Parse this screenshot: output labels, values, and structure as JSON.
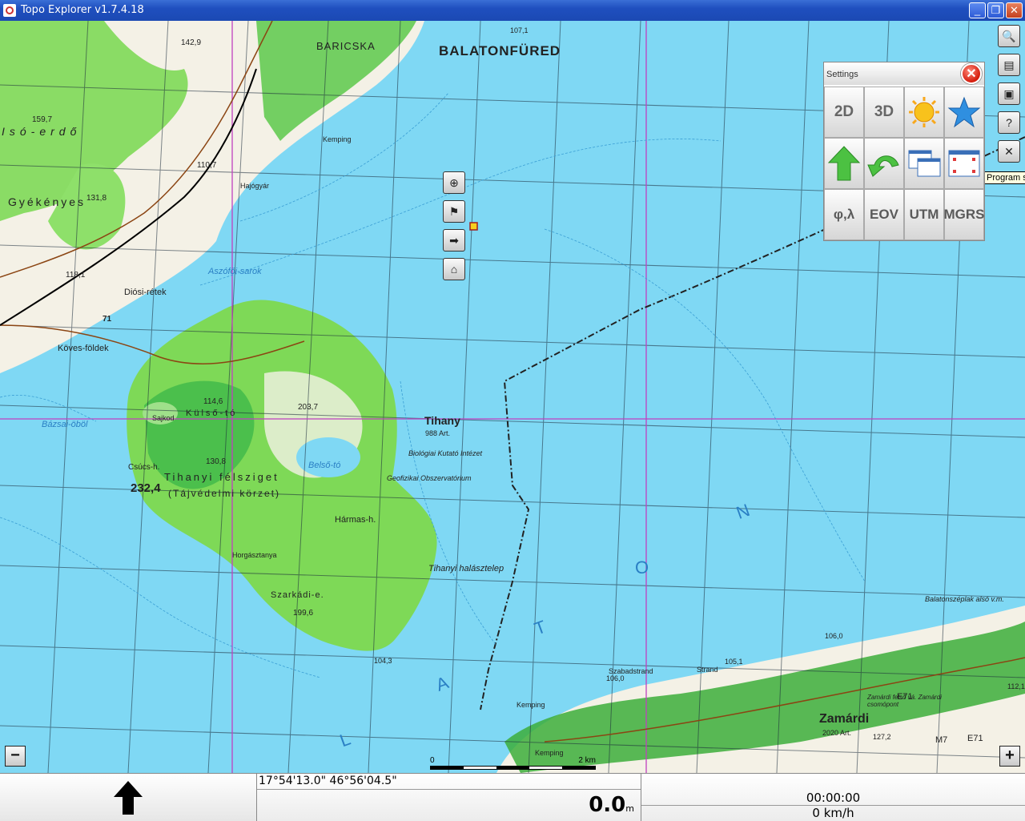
{
  "window": {
    "title": "Topo Explorer v1.7.4.18",
    "buttons": {
      "minimize": "_",
      "maximize": "❐",
      "close": "✕"
    }
  },
  "map": {
    "labels": {
      "balatonfured": "BALATONFÜRED",
      "baricska": "BARICSKA",
      "tihany": "Tihany",
      "tihany_pop": "988 Art.",
      "zamardi": "Zamárdi",
      "zamardi_pop": "2020 Art.",
      "kemping1": "Kemping",
      "kemping2": "Kemping",
      "kemping3": "Kemping",
      "hajogyar": "Hajógyár",
      "aszofoi_sarok": "Aszófői-sarok",
      "diosi_retek": "Diósi-rétek",
      "koves_foldek": "Köves-földek",
      "bazsai_obol": "Bázsai-öböl",
      "kulso_to": "Külső-tó",
      "belso_to": "Belső-tó",
      "biologiai": "Biológiai Kutató Intézet",
      "geofizikai": "Geofizikai Obszervatórium",
      "halasztelep": "Tihanyi halásztelep",
      "tihanyi_felsziget": "Tihanyi félsziget",
      "tajvedelmi": "(Tájvédelmi körzet)",
      "csucs_h": "Csúcs-h.",
      "peak_232": "232,4",
      "harmas_h": "Hármas-h.",
      "szarkadi": "Szarkádi-e.",
      "horgasztanya": "Horgásztanya",
      "szabadstrand": "Szabadstrand",
      "strand": "Strand",
      "balatonszeplak": "Balatonszéplak alsó v.m.",
      "zamardi_felso": "Zamárdi felső vá. Zamárdi csomópont",
      "gyekenyes": "Gyékényes",
      "iso_erdo": "Isó-erdő",
      "sajkod": "Sajkod",
      "M7": "M7",
      "E71a": "E71",
      "E71b": "E71",
      "val_142": "142,9",
      "val_159": "159,7",
      "val_131": "131,8",
      "val_118": "118,1",
      "val_110": "110,7",
      "val_114": "114,6",
      "val_203": "203,7",
      "val_130": "130,8",
      "val_199": "199,6",
      "val_104": "104,3",
      "val_105": "105,1",
      "val_106a": "106,0",
      "val_106b": "106,0",
      "val_107": "107,1",
      "val_127": "127,2",
      "val_112": "112,1",
      "val_71": "71",
      "letter_N": "N",
      "letter_O": "O",
      "letter_T": "T",
      "letter_A": "A",
      "letter_L": "L"
    },
    "scale": {
      "start": "0",
      "end": "2 km"
    },
    "nav_icons": [
      "crosshair-icon",
      "compass-icon",
      "forward-arrow-icon",
      "home-icon"
    ],
    "zoom_out": "−",
    "zoom_in": "+"
  },
  "toolbar_right": {
    "icons": [
      "search-icon",
      "layers-icon",
      "screenshot-icon",
      "help-icon",
      "tools-icon"
    ],
    "tooltip": "Program se"
  },
  "settings": {
    "title": "Settings",
    "close": "✕",
    "row1": [
      "2D",
      "3D",
      "sun-icon",
      "star-icon"
    ],
    "row2": [
      "up-arrow-icon",
      "undo-icon",
      "windows-icon",
      "fullscreen-icon"
    ],
    "row3": [
      "φ,λ",
      "EOV",
      "UTM",
      "MGRS"
    ]
  },
  "status": {
    "coords": "17°54'13.0\" 46°56'04.5\"",
    "altitude": "0.0",
    "altitude_unit": "m",
    "time": "00:00:00",
    "speed": "0 km/h"
  }
}
